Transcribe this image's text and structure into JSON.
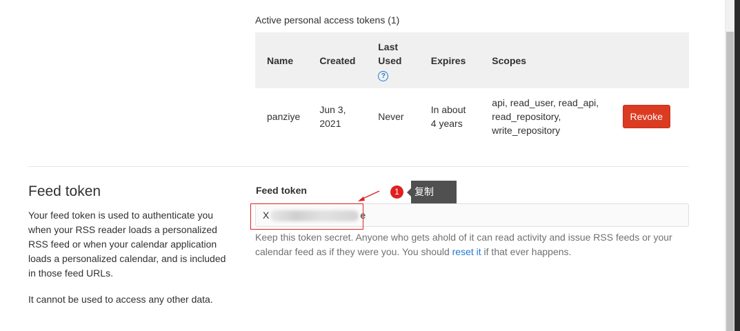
{
  "tokens": {
    "heading": "Active personal access tokens (1)",
    "columns": {
      "name": "Name",
      "created": "Created",
      "last_used": "Last Used",
      "expires": "Expires",
      "scopes": "Scopes"
    },
    "rows": [
      {
        "name": "panziye",
        "created": "Jun 3, 2021",
        "last_used": "Never",
        "expires": "In about 4 years",
        "scopes": "api, read_user, read_api, read_repository, write_repository",
        "action": "Revoke"
      }
    ]
  },
  "feed": {
    "title": "Feed token",
    "description": "Your feed token is used to authenticate you when your RSS reader loads a personalized RSS feed or when your calendar application loads a personalized calendar, and is included in those feed URLs.",
    "description2": "It cannot be used to access any other data.",
    "field_label": "Feed token",
    "token_start": "X",
    "token_end": "e",
    "help_before": "Keep this token secret. Anyone who gets ahold of it can read activity and issue RSS feeds or your calendar feed as if they were you. You should ",
    "help_link": "reset it",
    "help_after": " if that ever happens."
  },
  "annotation": {
    "step": "1",
    "label": "复制"
  },
  "colors": {
    "revoke": "#db3b21",
    "link": "#1f78d1",
    "annotation": "#e02020",
    "tooltip": "#505050"
  }
}
